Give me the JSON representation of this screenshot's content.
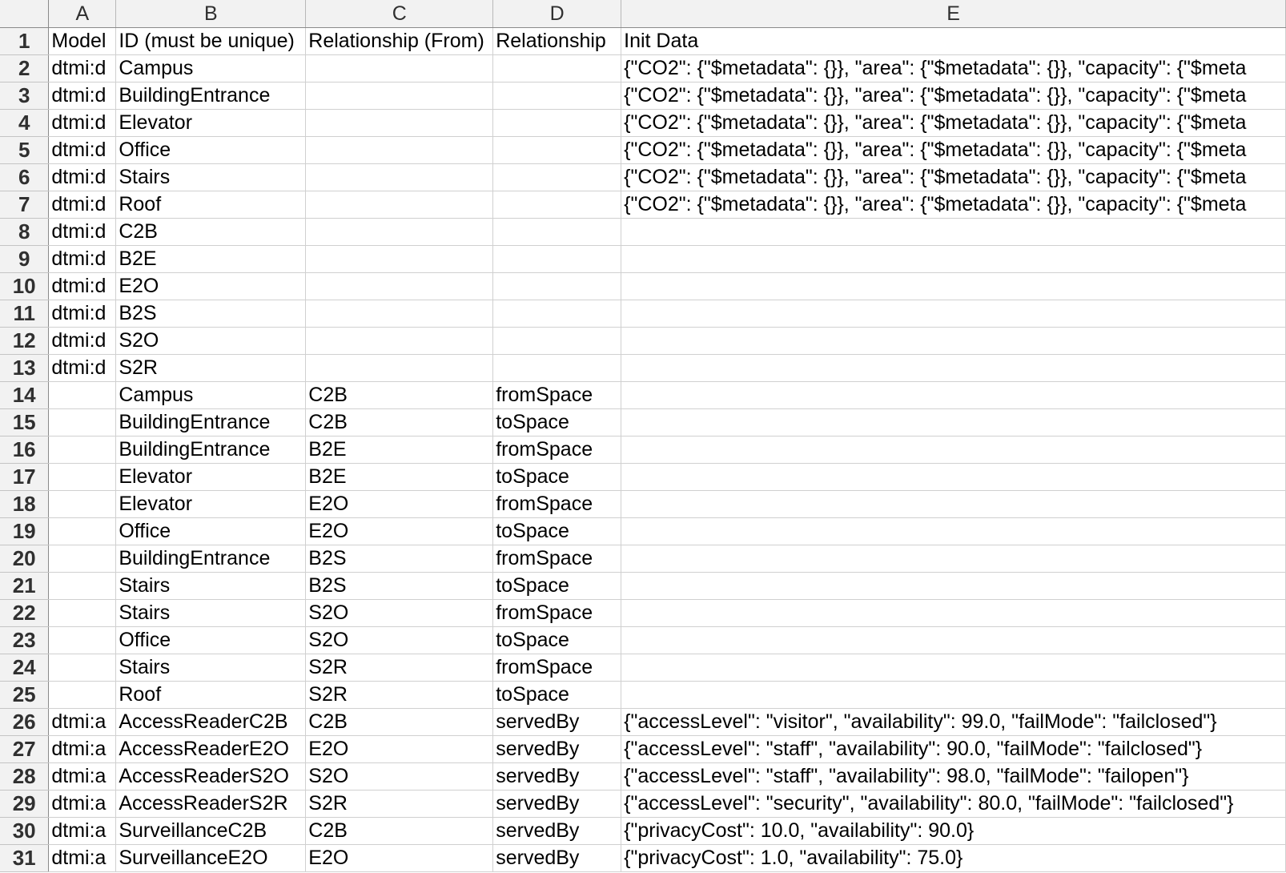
{
  "spreadsheet": {
    "columns": [
      "A",
      "B",
      "C",
      "D",
      "E"
    ],
    "rows": [
      {
        "num": "1",
        "cells": [
          "Model",
          "ID (must be unique)",
          "Relationship (From)",
          "Relationship",
          "Init Data"
        ]
      },
      {
        "num": "2",
        "cells": [
          "dtmi:d",
          "Campus",
          "",
          "",
          "{\"CO2\": {\"$metadata\": {}}, \"area\": {\"$metadata\": {}},  \"capacity\": {\"$meta"
        ]
      },
      {
        "num": "3",
        "cells": [
          "dtmi:d",
          "BuildingEntrance",
          "",
          "",
          "{\"CO2\": {\"$metadata\": {}}, \"area\": {\"$metadata\": {}},  \"capacity\": {\"$meta"
        ]
      },
      {
        "num": "4",
        "cells": [
          "dtmi:d",
          "Elevator",
          "",
          "",
          "{\"CO2\": {\"$metadata\": {}}, \"area\": {\"$metadata\": {}},  \"capacity\": {\"$meta"
        ]
      },
      {
        "num": "5",
        "cells": [
          "dtmi:d",
          "Office",
          "",
          "",
          "{\"CO2\": {\"$metadata\": {}}, \"area\": {\"$metadata\": {}},  \"capacity\": {\"$meta"
        ]
      },
      {
        "num": "6",
        "cells": [
          "dtmi:d",
          "Stairs",
          "",
          "",
          "{\"CO2\": {\"$metadata\": {}}, \"area\": {\"$metadata\": {}},  \"capacity\": {\"$meta"
        ]
      },
      {
        "num": "7",
        "cells": [
          "dtmi:d",
          "Roof",
          "",
          "",
          "{\"CO2\": {\"$metadata\": {}}, \"area\": {\"$metadata\": {}},  \"capacity\": {\"$meta"
        ]
      },
      {
        "num": "8",
        "cells": [
          "dtmi:d",
          "C2B",
          "",
          "",
          ""
        ]
      },
      {
        "num": "9",
        "cells": [
          "dtmi:d",
          "B2E",
          "",
          "",
          ""
        ]
      },
      {
        "num": "10",
        "cells": [
          "dtmi:d",
          "E2O",
          "",
          "",
          ""
        ]
      },
      {
        "num": "11",
        "cells": [
          "dtmi:d",
          "B2S",
          "",
          "",
          ""
        ]
      },
      {
        "num": "12",
        "cells": [
          "dtmi:d",
          "S2O",
          "",
          "",
          ""
        ]
      },
      {
        "num": "13",
        "cells": [
          "dtmi:d",
          "S2R",
          "",
          "",
          ""
        ]
      },
      {
        "num": "14",
        "cells": [
          "",
          "Campus",
          "C2B",
          "fromSpace",
          ""
        ]
      },
      {
        "num": "15",
        "cells": [
          "",
          "BuildingEntrance",
          "C2B",
          "toSpace",
          ""
        ]
      },
      {
        "num": "16",
        "cells": [
          "",
          "BuildingEntrance",
          "B2E",
          "fromSpace",
          ""
        ]
      },
      {
        "num": "17",
        "cells": [
          "",
          "Elevator",
          "B2E",
          "toSpace",
          ""
        ]
      },
      {
        "num": "18",
        "cells": [
          "",
          "Elevator",
          "E2O",
          "fromSpace",
          ""
        ]
      },
      {
        "num": "19",
        "cells": [
          "",
          "Office",
          "E2O",
          "toSpace",
          ""
        ]
      },
      {
        "num": "20",
        "cells": [
          "",
          "BuildingEntrance",
          "B2S",
          "fromSpace",
          ""
        ]
      },
      {
        "num": "21",
        "cells": [
          "",
          "Stairs",
          "B2S",
          "toSpace",
          ""
        ]
      },
      {
        "num": "22",
        "cells": [
          "",
          "Stairs",
          "S2O",
          "fromSpace",
          ""
        ]
      },
      {
        "num": "23",
        "cells": [
          "",
          "Office",
          "S2O",
          "toSpace",
          ""
        ]
      },
      {
        "num": "24",
        "cells": [
          "",
          "Stairs",
          "S2R",
          "fromSpace",
          ""
        ]
      },
      {
        "num": "25",
        "cells": [
          "",
          "Roof",
          "S2R",
          "toSpace",
          ""
        ]
      },
      {
        "num": "26",
        "cells": [
          "dtmi:a",
          "AccessReaderC2B",
          "C2B",
          "servedBy",
          "{\"accessLevel\": \"visitor\", \"availability\": 99.0, \"failMode\": \"failclosed\"}"
        ]
      },
      {
        "num": "27",
        "cells": [
          "dtmi:a",
          "AccessReaderE2O",
          "E2O",
          "servedBy",
          "{\"accessLevel\": \"staff\", \"availability\": 90.0, \"failMode\": \"failclosed\"}"
        ]
      },
      {
        "num": "28",
        "cells": [
          "dtmi:a",
          "AccessReaderS2O",
          "S2O",
          "servedBy",
          "{\"accessLevel\": \"staff\", \"availability\": 98.0,  \"failMode\": \"failopen\"}"
        ]
      },
      {
        "num": "29",
        "cells": [
          "dtmi:a",
          "AccessReaderS2R",
          "S2R",
          "servedBy",
          "{\"accessLevel\": \"security\", \"availability\": 80.0, \"failMode\": \"failclosed\"}"
        ]
      },
      {
        "num": "30",
        "cells": [
          "dtmi:a",
          "SurveillanceC2B",
          "C2B",
          "servedBy",
          "{\"privacyCost\": 10.0, \"availability\": 90.0}"
        ]
      },
      {
        "num": "31",
        "cells": [
          "dtmi:a",
          "SurveillanceE2O",
          "E2O",
          "servedBy",
          "{\"privacyCost\": 1.0, \"availability\": 75.0}"
        ]
      }
    ]
  }
}
